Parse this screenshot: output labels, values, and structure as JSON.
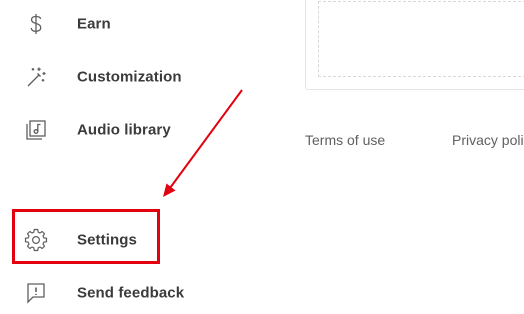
{
  "sidebar": {
    "items": [
      {
        "label": "Earn",
        "icon": "dollar-icon"
      },
      {
        "label": "Customization",
        "icon": "magic-wand-icon"
      },
      {
        "label": "Audio library",
        "icon": "audio-library-icon"
      },
      {
        "label": "Settings",
        "icon": "gear-icon"
      },
      {
        "label": "Send feedback",
        "icon": "feedback-icon"
      }
    ]
  },
  "footer": {
    "terms_label": "Terms of use",
    "privacy_label": "Privacy poli"
  },
  "colors": {
    "highlight": "#e3000f",
    "icon": "#5f5f5f",
    "label": "#3b3b3b"
  }
}
